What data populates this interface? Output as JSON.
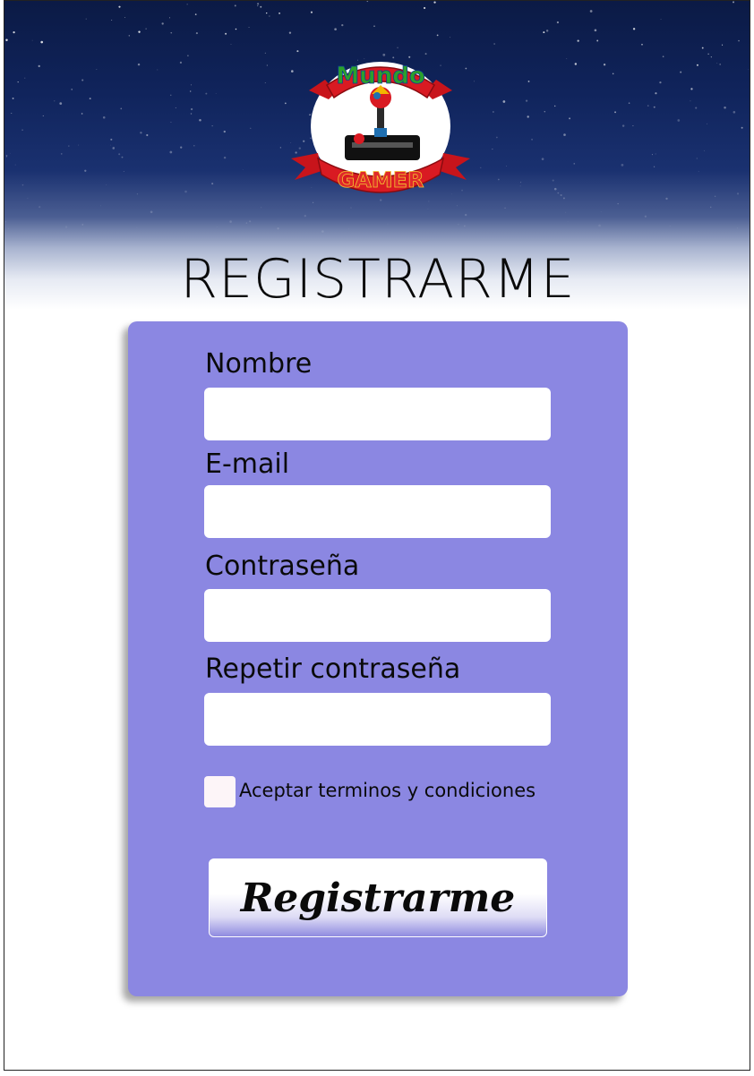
{
  "logo": {
    "banner_top_text": "Mundo",
    "banner_bottom_text": "GAMER"
  },
  "page": {
    "title": "REGISTRARME"
  },
  "form": {
    "fields": [
      {
        "label": "Nombre",
        "value": "",
        "placeholder": ""
      },
      {
        "label": "E-mail",
        "value": "",
        "placeholder": ""
      },
      {
        "label": "Contraseña",
        "value": "",
        "placeholder": ""
      },
      {
        "label": "Repetir contraseña",
        "value": "",
        "placeholder": ""
      }
    ],
    "terms_label": "Aceptar terminos y condiciones",
    "terms_checked": false,
    "submit_label": "Registrarme"
  },
  "colors": {
    "card_background": "#8b87e2",
    "sky_dark": "#0b1a45",
    "input_background": "#ffffff"
  }
}
